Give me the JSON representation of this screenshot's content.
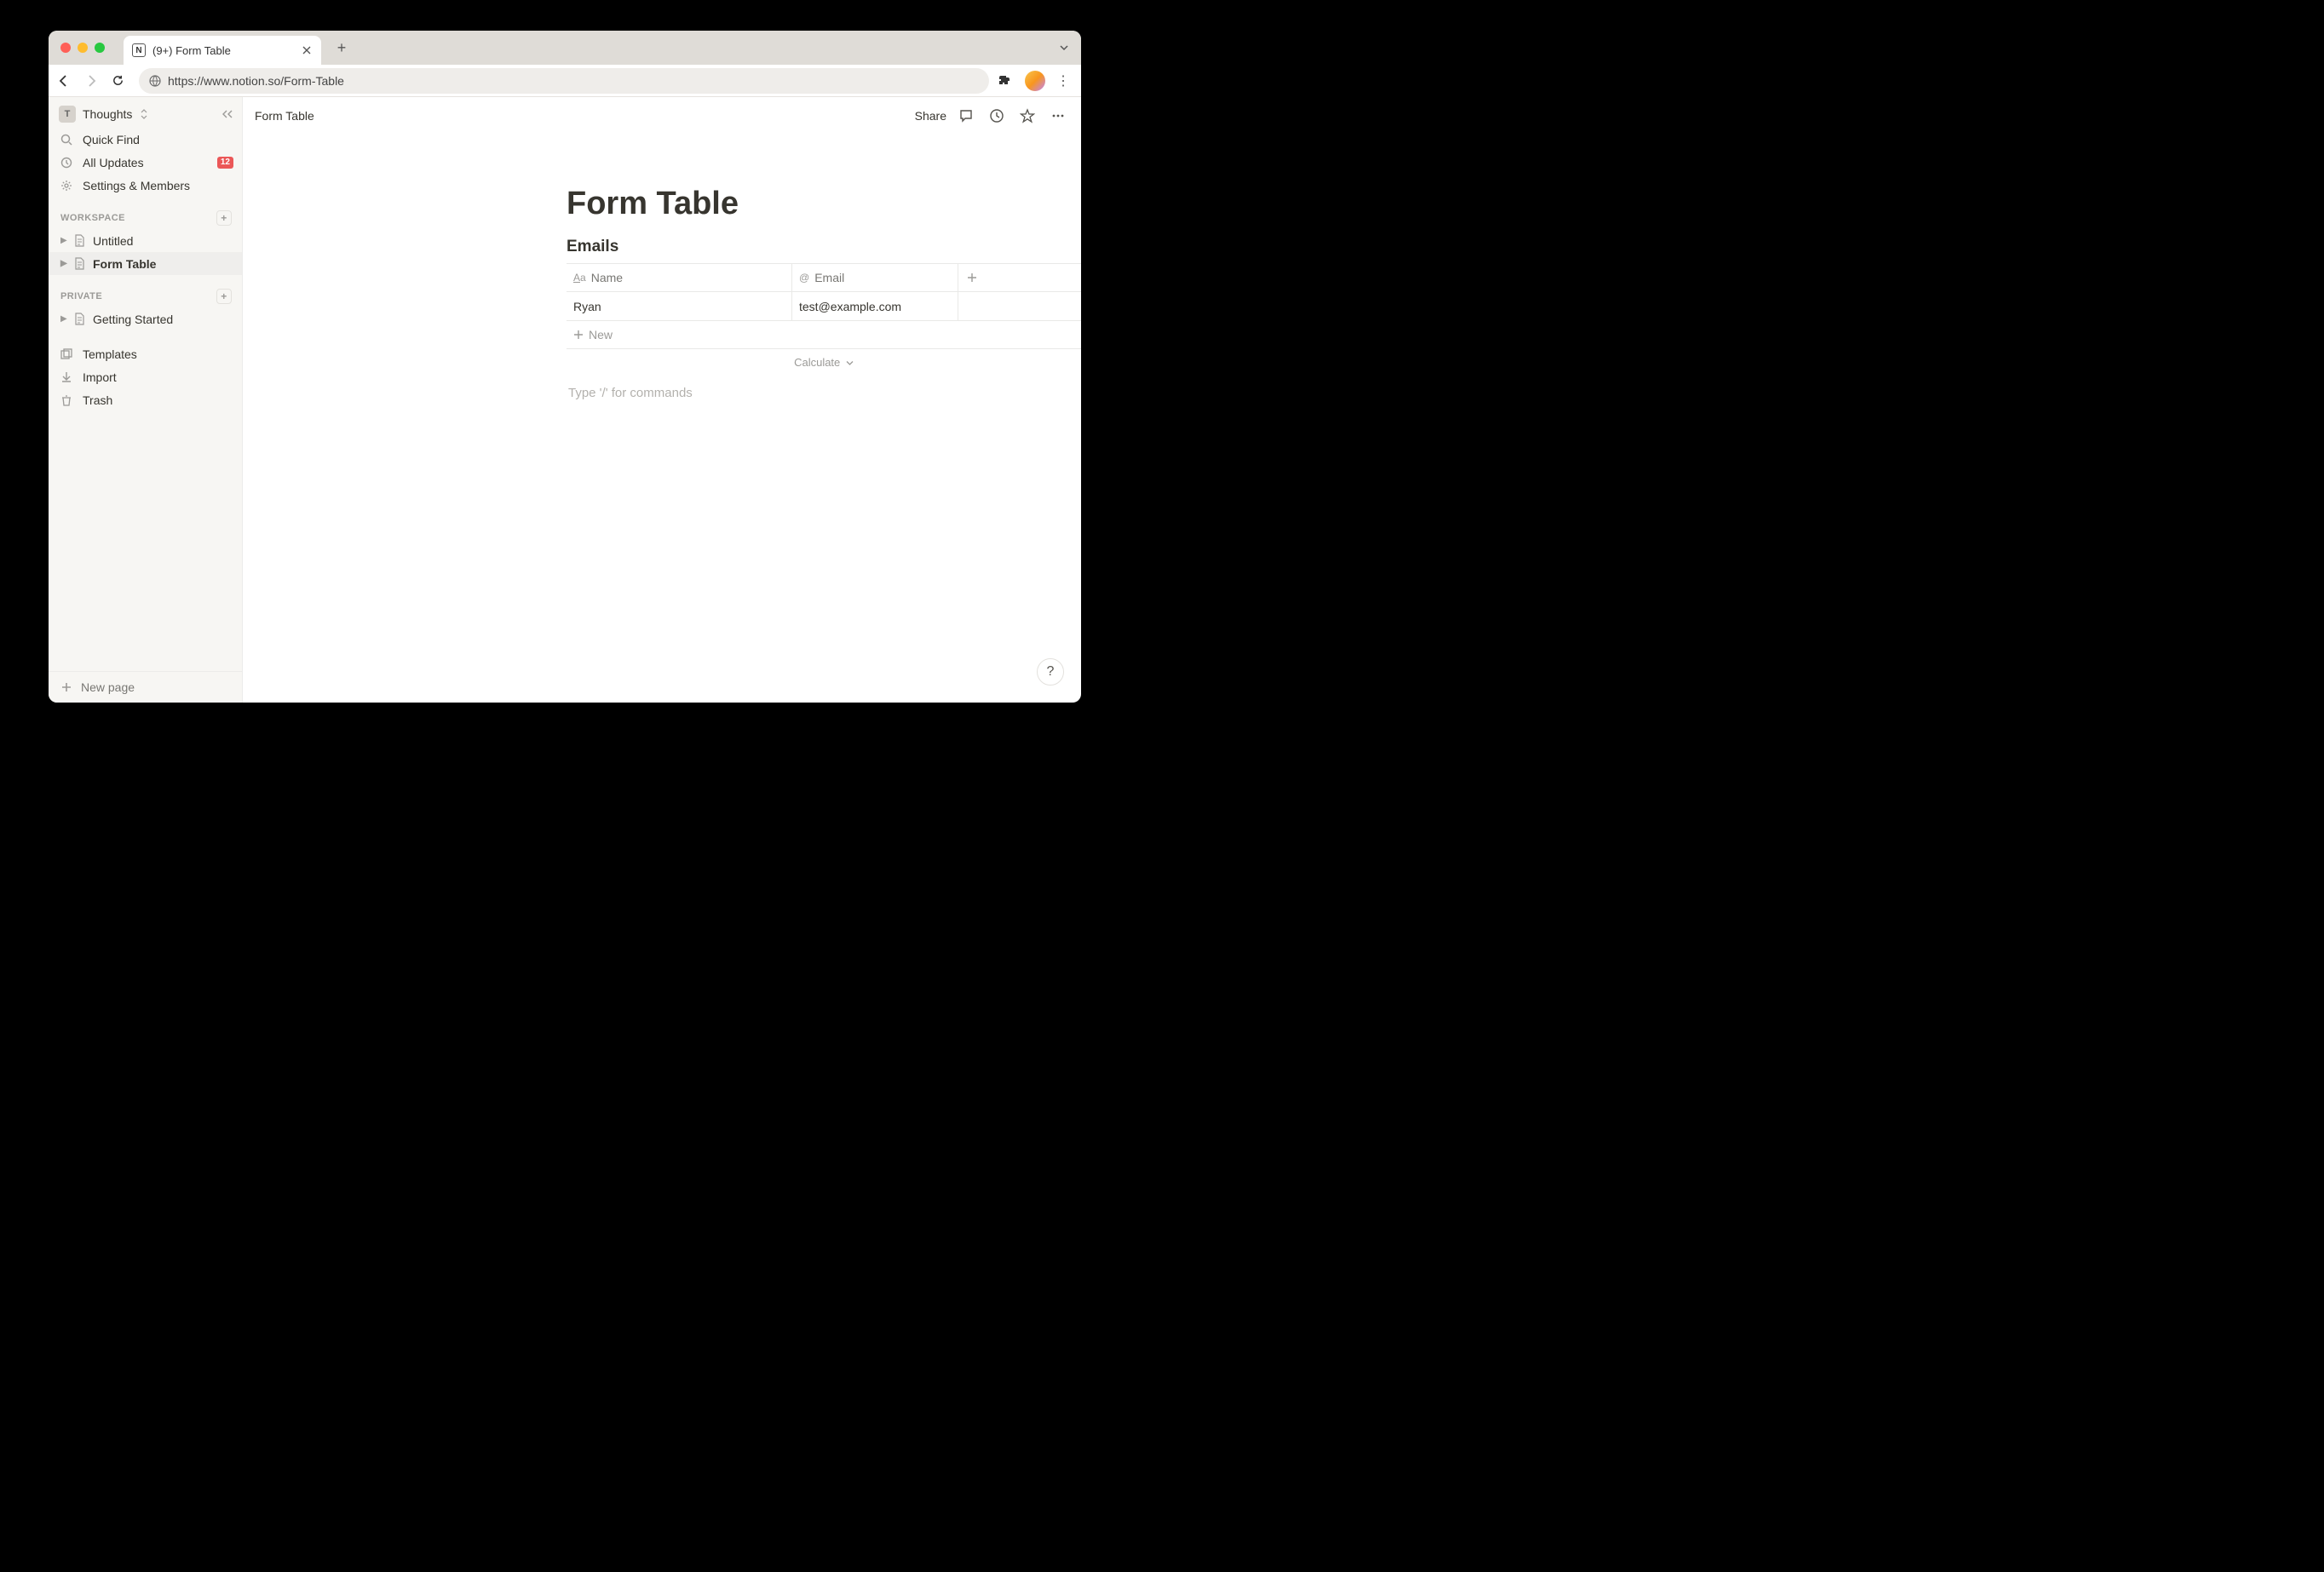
{
  "browser": {
    "tab_title": "(9+) Form Table",
    "url": "https://www.notion.so/Form-Table"
  },
  "workspace": {
    "initial": "T",
    "name": "Thoughts"
  },
  "sidebar": {
    "quick_find": "Quick Find",
    "all_updates": "All Updates",
    "updates_badge": "12",
    "settings": "Settings & Members",
    "section_workspace": "WORKSPACE",
    "pages_workspace": [
      {
        "label": "Untitled"
      },
      {
        "label": "Form Table"
      }
    ],
    "section_private": "PRIVATE",
    "pages_private": [
      {
        "label": "Getting Started"
      }
    ],
    "templates": "Templates",
    "import": "Import",
    "trash": "Trash",
    "new_page": "New page"
  },
  "topbar": {
    "breadcrumb": "Form Table",
    "share": "Share"
  },
  "page": {
    "title": "Form Table",
    "db_title": "Emails",
    "columns": {
      "name": "Name",
      "email": "Email"
    },
    "rows": [
      {
        "name": "Ryan",
        "email": "test@example.com"
      }
    ],
    "new_row": "New",
    "calculate": "Calculate",
    "slash_hint": "Type '/' for commands"
  }
}
